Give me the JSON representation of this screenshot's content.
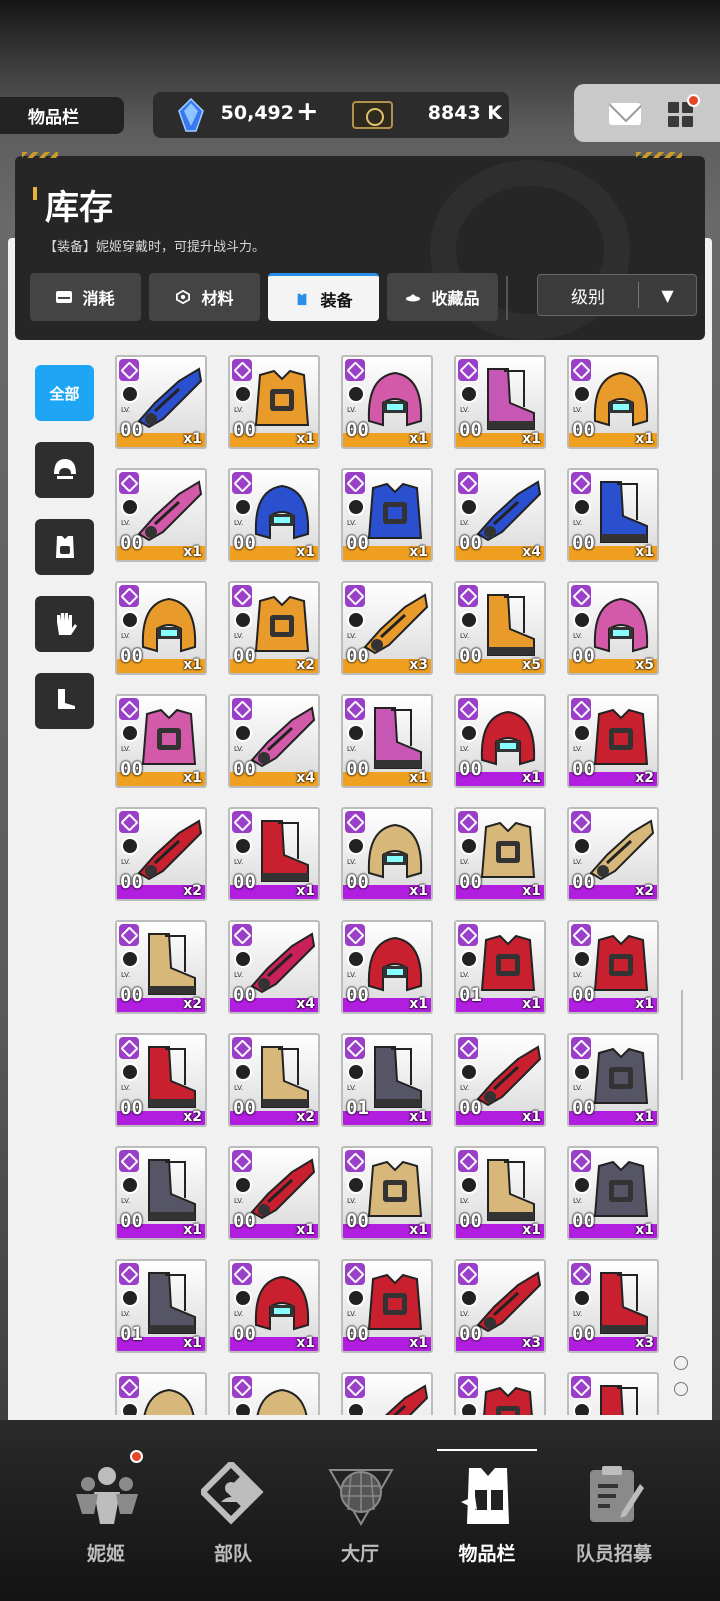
{
  "top_bar": {
    "section_title": "物品栏",
    "gems": "50,492",
    "gems_add": "+",
    "credits": "8843 K"
  },
  "header": {
    "title": "库存",
    "description": "【装备】妮姬穿戴时，可提升战斗力。"
  },
  "tabs": [
    {
      "label": "消耗",
      "icon": "consumable-icon",
      "active": false
    },
    {
      "label": "材料",
      "icon": "material-icon",
      "active": false
    },
    {
      "label": "装备",
      "icon": "equipment-icon",
      "active": true
    },
    {
      "label": "收藏品",
      "icon": "collection-icon",
      "active": false
    }
  ],
  "sort": {
    "label": "级别",
    "arrow": "▼"
  },
  "side_filters": [
    {
      "label": "全部",
      "icon": "",
      "active": true
    },
    {
      "label": "",
      "icon": "helmet-icon",
      "active": false
    },
    {
      "label": "",
      "icon": "armor-icon",
      "active": false
    },
    {
      "label": "",
      "icon": "gloves-icon",
      "active": false
    },
    {
      "label": "",
      "icon": "boots-icon",
      "active": false
    }
  ],
  "item_rows": [
    [
      {
        "lv": "00",
        "cnt": "x1",
        "tier": "orange",
        "part": "arm",
        "color": "#2a4fcf"
      },
      {
        "lv": "00",
        "cnt": "x1",
        "tier": "orange",
        "part": "armor",
        "color": "#e89a2a"
      },
      {
        "lv": "00",
        "cnt": "x1",
        "tier": "orange",
        "part": "helmet",
        "color": "#d35aa8"
      },
      {
        "lv": "00",
        "cnt": "x1",
        "tier": "orange",
        "part": "boots",
        "color": "#c657b4"
      },
      {
        "lv": "00",
        "cnt": "x1",
        "tier": "orange",
        "part": "helmet",
        "color": "#e89a2a"
      }
    ],
    [
      {
        "lv": "00",
        "cnt": "x1",
        "tier": "orange",
        "part": "arm",
        "color": "#d35aa8"
      },
      {
        "lv": "00",
        "cnt": "x1",
        "tier": "orange",
        "part": "helmet",
        "color": "#2a4fcf"
      },
      {
        "lv": "00",
        "cnt": "x1",
        "tier": "orange",
        "part": "armor",
        "color": "#2a4fcf"
      },
      {
        "lv": "00",
        "cnt": "x4",
        "tier": "orange",
        "part": "arm",
        "color": "#2a4fcf"
      },
      {
        "lv": "00",
        "cnt": "x1",
        "tier": "orange",
        "part": "boots",
        "color": "#2a4fcf"
      }
    ],
    [
      {
        "lv": "00",
        "cnt": "x1",
        "tier": "orange",
        "part": "helmet",
        "color": "#e89a2a"
      },
      {
        "lv": "00",
        "cnt": "x2",
        "tier": "orange",
        "part": "armor",
        "color": "#e89a2a"
      },
      {
        "lv": "00",
        "cnt": "x3",
        "tier": "orange",
        "part": "arm",
        "color": "#e89a2a"
      },
      {
        "lv": "00",
        "cnt": "x5",
        "tier": "orange",
        "part": "boots",
        "color": "#e89a2a"
      },
      {
        "lv": "00",
        "cnt": "x5",
        "tier": "orange",
        "part": "helmet",
        "color": "#d35aa8"
      }
    ],
    [
      {
        "lv": "00",
        "cnt": "x1",
        "tier": "orange",
        "part": "armor",
        "color": "#d35aa8"
      },
      {
        "lv": "00",
        "cnt": "x4",
        "tier": "orange",
        "part": "arm",
        "color": "#d35aa8"
      },
      {
        "lv": "00",
        "cnt": "x1",
        "tier": "orange",
        "part": "boots",
        "color": "#c657b4"
      },
      {
        "lv": "00",
        "cnt": "x1",
        "tier": "purple",
        "part": "helmet",
        "color": "#c8202e"
      },
      {
        "lv": "00",
        "cnt": "x2",
        "tier": "purple",
        "part": "armor",
        "color": "#c8202e"
      }
    ],
    [
      {
        "lv": "00",
        "cnt": "x2",
        "tier": "purple",
        "part": "arm",
        "color": "#c8202e"
      },
      {
        "lv": "00",
        "cnt": "x1",
        "tier": "purple",
        "part": "boots",
        "color": "#c8202e"
      },
      {
        "lv": "00",
        "cnt": "x1",
        "tier": "purple",
        "part": "helmet",
        "color": "#d8b87a"
      },
      {
        "lv": "00",
        "cnt": "x1",
        "tier": "purple",
        "part": "armor",
        "color": "#d8b87a"
      },
      {
        "lv": "00",
        "cnt": "x2",
        "tier": "purple",
        "part": "arm",
        "color": "#d8b87a"
      }
    ],
    [
      {
        "lv": "00",
        "cnt": "x2",
        "tier": "purple",
        "part": "boots",
        "color": "#d8b87a"
      },
      {
        "lv": "00",
        "cnt": "x4",
        "tier": "purple",
        "part": "arm",
        "color": "#c8205a"
      },
      {
        "lv": "00",
        "cnt": "x1",
        "tier": "purple",
        "part": "helmet",
        "color": "#c8202e"
      },
      {
        "lv": "01",
        "cnt": "x1",
        "tier": "purple",
        "part": "armor",
        "color": "#c8202e"
      },
      {
        "lv": "00",
        "cnt": "x1",
        "tier": "purple",
        "part": "armor",
        "color": "#c8202e"
      }
    ],
    [
      {
        "lv": "00",
        "cnt": "x2",
        "tier": "purple",
        "part": "boots",
        "color": "#c8202e"
      },
      {
        "lv": "00",
        "cnt": "x2",
        "tier": "purple",
        "part": "boots",
        "color": "#d8b87a"
      },
      {
        "lv": "01",
        "cnt": "x1",
        "tier": "purple",
        "part": "boots",
        "color": "#555566"
      },
      {
        "lv": "00",
        "cnt": "x1",
        "tier": "purple",
        "part": "arm",
        "color": "#c8202e"
      },
      {
        "lv": "00",
        "cnt": "x1",
        "tier": "purple",
        "part": "armor",
        "color": "#555566"
      }
    ],
    [
      {
        "lv": "00",
        "cnt": "x1",
        "tier": "purple",
        "part": "boots",
        "color": "#555566"
      },
      {
        "lv": "00",
        "cnt": "x1",
        "tier": "purple",
        "part": "arm",
        "color": "#c8202e"
      },
      {
        "lv": "00",
        "cnt": "x1",
        "tier": "purple",
        "part": "armor",
        "color": "#d8b87a"
      },
      {
        "lv": "00",
        "cnt": "x1",
        "tier": "purple",
        "part": "boots",
        "color": "#d8b87a"
      },
      {
        "lv": "00",
        "cnt": "x1",
        "tier": "purple",
        "part": "armor",
        "color": "#555566"
      }
    ],
    [
      {
        "lv": "01",
        "cnt": "x1",
        "tier": "purple",
        "part": "boots",
        "color": "#555566"
      },
      {
        "lv": "00",
        "cnt": "x1",
        "tier": "purple",
        "part": "helmet",
        "color": "#c8202e"
      },
      {
        "lv": "00",
        "cnt": "x1",
        "tier": "purple",
        "part": "armor",
        "color": "#c8202e"
      },
      {
        "lv": "00",
        "cnt": "x3",
        "tier": "purple",
        "part": "arm",
        "color": "#c8202e"
      },
      {
        "lv": "00",
        "cnt": "x3",
        "tier": "purple",
        "part": "boots",
        "color": "#c8202e"
      }
    ],
    [
      {
        "lv": "",
        "cnt": "",
        "tier": "purple",
        "part": "helmet",
        "color": "#d8b87a"
      },
      {
        "lv": "",
        "cnt": "",
        "tier": "purple",
        "part": "helmet",
        "color": "#d8b87a"
      },
      {
        "lv": "",
        "cnt": "",
        "tier": "purple",
        "part": "arm",
        "color": "#c8202e"
      },
      {
        "lv": "",
        "cnt": "",
        "tier": "purple",
        "part": "armor",
        "color": "#c8202e"
      },
      {
        "lv": "",
        "cnt": "",
        "tier": "purple",
        "part": "boots",
        "color": "#c8202e"
      }
    ]
  ],
  "item_level_prefix": "LV.",
  "tier_colors": {
    "orange": "#f0a020",
    "purple": "#b21ee0",
    "rank_orange": "#9a3fc8",
    "rank_purple": "#9a3fc8"
  },
  "bottom_nav": [
    {
      "label": "妮姬",
      "icon": "nikke-icon",
      "active": false,
      "badge": true
    },
    {
      "label": "部队",
      "icon": "squad-icon",
      "active": false,
      "badge": false
    },
    {
      "label": "大厅",
      "icon": "lobby-icon",
      "active": false,
      "badge": false
    },
    {
      "label": "物品栏",
      "icon": "inventory-icon",
      "active": true,
      "badge": false
    },
    {
      "label": "队员招募",
      "icon": "recruit-icon",
      "active": false,
      "badge": false
    }
  ]
}
